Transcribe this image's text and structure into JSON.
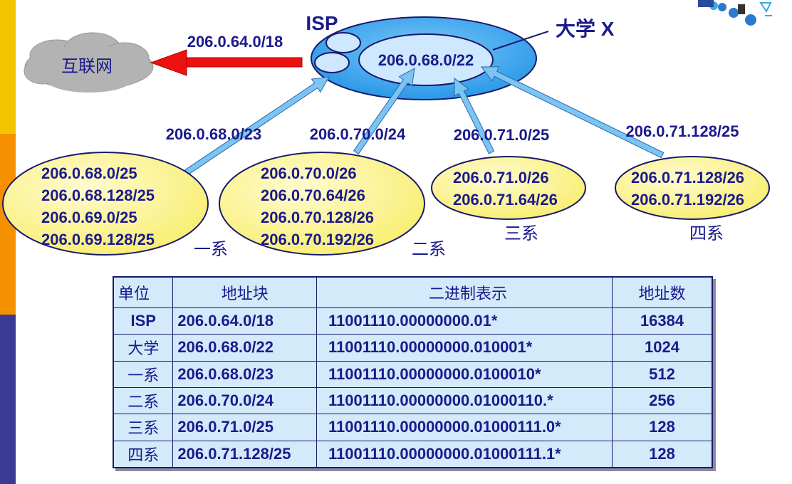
{
  "diagram": {
    "internet_label": "互联网",
    "isp_label": "ISP",
    "isp_route": "206.0.64.0/18",
    "university_label": "大学 X",
    "university_block": "206.0.68.0/22",
    "links": [
      {
        "id": "dept1",
        "prefix": "206.0.68.0/23"
      },
      {
        "id": "dept2",
        "prefix": "206.0.70.0/24"
      },
      {
        "id": "dept3",
        "prefix": "206.0.71.0/25"
      },
      {
        "id": "dept4",
        "prefix": "206.0.71.128/25"
      }
    ],
    "departments": [
      {
        "name": "一系",
        "subnets": [
          "206.0.68.0/25",
          "206.0.68.128/25",
          "206.0.69.0/25",
          "206.0.69.128/25"
        ]
      },
      {
        "name": "二系",
        "subnets": [
          "206.0.70.0/26",
          "206.0.70.64/26",
          "206.0.70.128/26",
          "206.0.70.192/26"
        ]
      },
      {
        "name": "三系",
        "subnets": [
          "206.0.71.0/26",
          "206.0.71.64/26"
        ]
      },
      {
        "name": "四系",
        "subnets": [
          "206.0.71.128/26",
          "206.0.71.192/26"
        ]
      }
    ]
  },
  "table": {
    "headers": [
      "单位",
      "地址块",
      "二进制表示",
      "地址数"
    ],
    "rows": [
      [
        "ISP",
        "206.0.64.0/18",
        "11001110.00000000.01*",
        "16384"
      ],
      [
        "大学",
        "206.0.68.0/22",
        "11001110.00000000.010001*",
        "1024"
      ],
      [
        "一系",
        "206.0.68.0/23",
        "11001110.00000000.0100010*",
        "512"
      ],
      [
        "二系",
        "206.0.70.0/24",
        "11001110.00000000.01000110.*",
        "256"
      ],
      [
        "三系",
        "206.0.71.0/25",
        "11001110.00000000.01000111.0*",
        "128"
      ],
      [
        "四系",
        "206.0.71.128/25",
        "11001110.00000000.01000111.1*",
        "128"
      ]
    ]
  },
  "colors": {
    "text": "#1a1a8c",
    "isp_fill": "#3aa8ee",
    "university_fill": "#cde8ff",
    "dept_fill": "#fdf59a",
    "internet_arrow": "#ee1111",
    "link_arrow": "#7cc4f4",
    "table_fill": "#d2eafa",
    "sidebar": [
      "#f5c400",
      "#f59100",
      "#3a3a94"
    ]
  }
}
